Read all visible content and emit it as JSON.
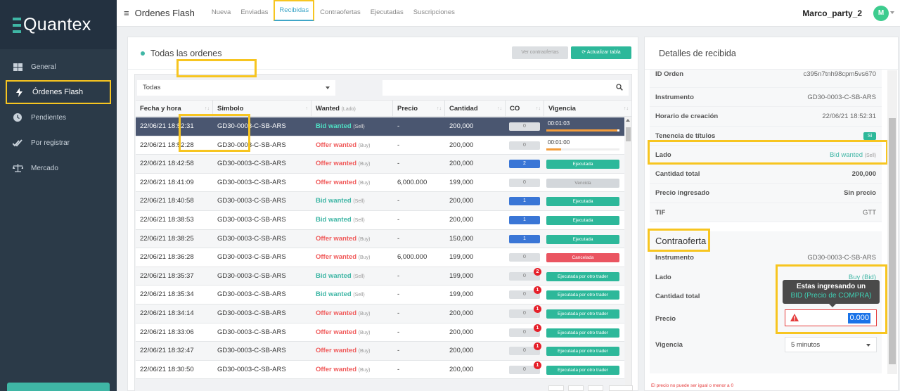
{
  "brand": {
    "name": "Quantex",
    "accent": "#3fb6a5"
  },
  "sidebar": {
    "items": [
      {
        "label": "General",
        "icon": "grid-icon",
        "active": false
      },
      {
        "label": "Órdenes Flash",
        "icon": "bolt-icon",
        "active": true
      },
      {
        "label": "Pendientes",
        "icon": "clock-icon",
        "active": false
      },
      {
        "label": "Por registrar",
        "icon": "check-double-icon",
        "active": false
      },
      {
        "label": "Mercado",
        "icon": "scale-icon",
        "active": false
      }
    ]
  },
  "topbar": {
    "title": "Ordenes Flash",
    "tabs": [
      "Nueva",
      "Enviadas",
      "Recibidas",
      "Contraofertas",
      "Ejecutadas",
      "Suscripciones"
    ],
    "active_tab": "Recibidas",
    "user": "Marco_party_2",
    "avatar_initial": "M"
  },
  "orders": {
    "title": "Todas las ordenes",
    "ver_button": "Ver contraofertas",
    "refresh_button": "Actualizar tabla",
    "filter_value": "Todas",
    "columns": [
      "Fecha y hora",
      "Simbolo",
      "Wanted",
      "Precio",
      "Cantidad",
      "CO",
      "Vigencia"
    ],
    "wanted_sub": "(Lado)",
    "rows": [
      {
        "fecha": "22/06/21 18:52:31",
        "simbolo": "GD30-0003-C-SB-ARS",
        "wanted": "Bid wanted",
        "lado": "(Sell)",
        "precio": "-",
        "cantidad": "200,000",
        "co": "0",
        "badge": "",
        "vig_type": "timer",
        "vig": "00:01:03",
        "progress": 0.97
      },
      {
        "fecha": "22/06/21 18:52:28",
        "simbolo": "GD30-0003-C-SB-ARS",
        "wanted": "Offer wanted",
        "lado": "(Buy)",
        "precio": "-",
        "cantidad": "200,000",
        "co": "0",
        "badge": "",
        "vig_type": "timer",
        "vig": "00:01:00",
        "progress": 0.2
      },
      {
        "fecha": "22/06/21 18:42:58",
        "simbolo": "GD30-0003-C-SB-ARS",
        "wanted": "Offer wanted",
        "lado": "(Buy)",
        "precio": "-",
        "cantidad": "200,000",
        "co": "2",
        "badge": "",
        "vig_type": "ej",
        "vig": "Ejecutada"
      },
      {
        "fecha": "22/06/21 18:41:09",
        "simbolo": "GD30-0003-C-SB-ARS",
        "wanted": "Offer wanted",
        "lado": "(Buy)",
        "precio": "6,000.000",
        "cantidad": "199,000",
        "co": "0",
        "badge": "",
        "vig_type": "ven",
        "vig": "Vencida"
      },
      {
        "fecha": "22/06/21 18:40:58",
        "simbolo": "GD30-0003-C-SB-ARS",
        "wanted": "Bid wanted",
        "lado": "(Sell)",
        "precio": "-",
        "cantidad": "200,000",
        "co": "1",
        "badge": "",
        "vig_type": "ej",
        "vig": "Ejecutada"
      },
      {
        "fecha": "22/06/21 18:38:53",
        "simbolo": "GD30-0003-C-SB-ARS",
        "wanted": "Bid wanted",
        "lado": "(Sell)",
        "precio": "-",
        "cantidad": "200,000",
        "co": "1",
        "badge": "",
        "vig_type": "ej",
        "vig": "Ejecutada"
      },
      {
        "fecha": "22/06/21 18:38:25",
        "simbolo": "GD30-0003-C-SB-ARS",
        "wanted": "Offer wanted",
        "lado": "(Buy)",
        "precio": "-",
        "cantidad": "150,000",
        "co": "1",
        "badge": "",
        "vig_type": "ej",
        "vig": "Ejecutada"
      },
      {
        "fecha": "22/06/21 18:36:28",
        "simbolo": "GD30-0003-C-SB-ARS",
        "wanted": "Offer wanted",
        "lado": "(Buy)",
        "precio": "6,000.000",
        "cantidad": "199,000",
        "co": "0",
        "badge": "",
        "vig_type": "can",
        "vig": "Cancelada"
      },
      {
        "fecha": "22/06/21 18:35:37",
        "simbolo": "GD30-0003-C-SB-ARS",
        "wanted": "Bid wanted",
        "lado": "(Sell)",
        "precio": "-",
        "cantidad": "199,000",
        "co": "0",
        "badge": "2",
        "vig_type": "ej",
        "vig": "Ejecutada por otro trader"
      },
      {
        "fecha": "22/06/21 18:35:34",
        "simbolo": "GD30-0003-C-SB-ARS",
        "wanted": "Bid wanted",
        "lado": "(Sell)",
        "precio": "-",
        "cantidad": "199,000",
        "co": "0",
        "badge": "1",
        "vig_type": "ej",
        "vig": "Ejecutada por otro trader"
      },
      {
        "fecha": "22/06/21 18:34:14",
        "simbolo": "GD30-0003-C-SB-ARS",
        "wanted": "Offer wanted",
        "lado": "(Buy)",
        "precio": "-",
        "cantidad": "200,000",
        "co": "0",
        "badge": "1",
        "vig_type": "ej",
        "vig": "Ejecutada por otro trader"
      },
      {
        "fecha": "22/06/21 18:33:06",
        "simbolo": "GD30-0003-C-SB-ARS",
        "wanted": "Offer wanted",
        "lado": "(Buy)",
        "precio": "-",
        "cantidad": "200,000",
        "co": "0",
        "badge": "1",
        "vig_type": "ej",
        "vig": "Ejecutada por otro trader"
      },
      {
        "fecha": "22/06/21 18:32:47",
        "simbolo": "GD30-0003-C-SB-ARS",
        "wanted": "Offer wanted",
        "lado": "(Buy)",
        "precio": "-",
        "cantidad": "200,000",
        "co": "0",
        "badge": "1",
        "vig_type": "ej",
        "vig": "Ejecutada por otro trader"
      },
      {
        "fecha": "22/06/21 18:30:50",
        "simbolo": "GD30-0003-C-SB-ARS",
        "wanted": "Offer wanted",
        "lado": "(Buy)",
        "precio": "-",
        "cantidad": "200,000",
        "co": "0",
        "badge": "1",
        "vig_type": "ej",
        "vig": "Ejecutada por otro trader"
      }
    ]
  },
  "details": {
    "title": "Detalles de recibida",
    "rows": [
      {
        "label": "ID Orden",
        "value": "c395n7tnh98cpm5vs670"
      },
      {
        "label": "Instrumento",
        "value": "GD30-0003-C-SB-ARS"
      },
      {
        "label": "Horario de creación",
        "value": "22/06/21 18:52:31"
      },
      {
        "label": "Tenencia de títulos",
        "value": "Si"
      },
      {
        "label": "Lado",
        "value": "Bid wanted",
        "sub": "(Sell)"
      },
      {
        "label": "Cantidad total",
        "value": "200,000"
      },
      {
        "label": "Precio ingresado",
        "value": "Sin precio"
      },
      {
        "label": "TIF",
        "value": "GTT"
      }
    ]
  },
  "contraoferta": {
    "title": "Contraoferta",
    "instrumento_label": "Instrumento",
    "instrumento": "GD30-0003-C-SB-ARS",
    "lado_label": "Lado",
    "lado": "Buy (Bid)",
    "cantidad_label": "Cantidad total",
    "precio_label": "Precio",
    "precio_value": "0.000",
    "vigencia_label": "Vigencia",
    "vigencia": "5 minutos",
    "tooltip_line1": "Estas ingresando un",
    "tooltip_line2": "BID (Precio de COMPRA)",
    "error": "El precio no puede ser igual o menor a 0"
  }
}
